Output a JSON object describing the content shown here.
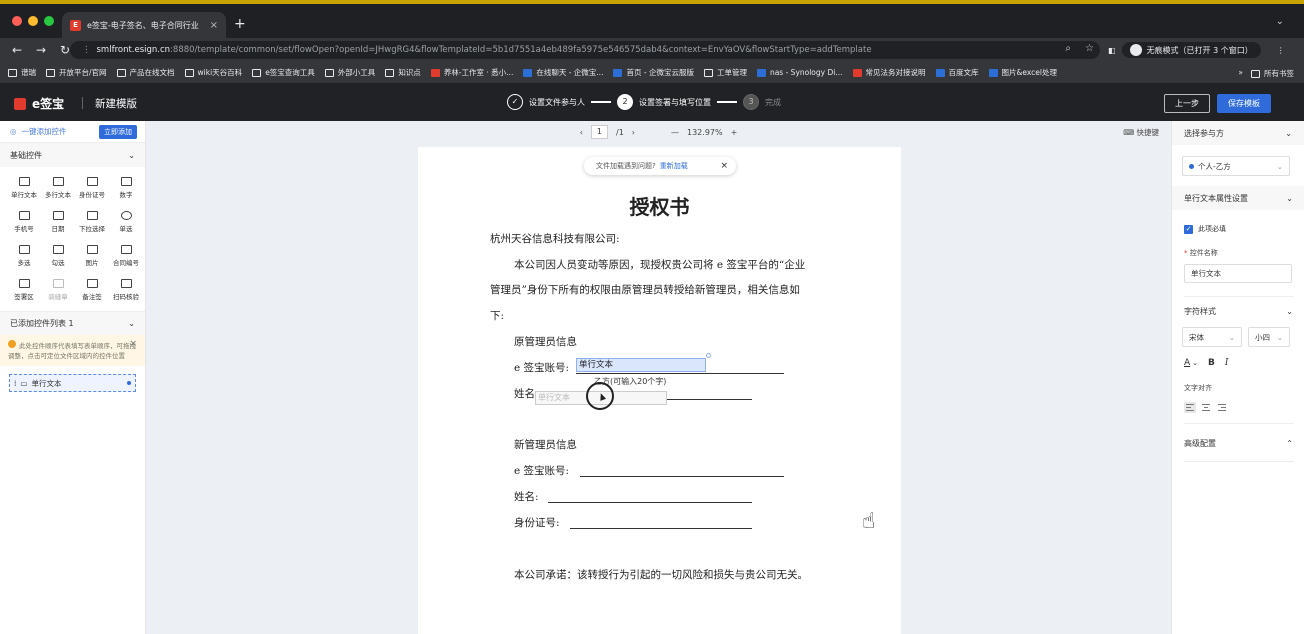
{
  "browser": {
    "tab_title": "e签宝-电子签名、电子合同行业",
    "tab_close": "×",
    "new_tab": "+",
    "url_host": "smlfront.esign.cn",
    "url_rest": ":8880/template/common/set/flowOpen?openId=JHwgRG4&flowTemplateId=5b1d7551a4eb489fa5975e546575dab4&context=EnvYaOV&flowStartType=addTemplate",
    "incognito_label": "无痕模式（已打开 3 个窗口）",
    "bookmarks": [
      "谱瑞",
      "开放平台/官网",
      "产品在线文档",
      "wiki天谷百科",
      "e签宝查询工具",
      "外部小工具",
      "知识点",
      "养林-工作室 · 悉小...",
      "在线聊天 - 企微宝...",
      "首页 - 企微宝云服版",
      "工单管理",
      "nas - Synology Di...",
      "常见法务对接说明",
      "百度文库",
      "图片&excel处理"
    ],
    "bookmarks_more": "»",
    "bookmarks_all": "所有书签"
  },
  "app": {
    "logo_text": "e签宝",
    "page_name": "新建模版",
    "steps": [
      {
        "num": "✓",
        "label": "设置文件参与人"
      },
      {
        "num": "2",
        "label": "设置签署与填写位置"
      },
      {
        "num": "3",
        "label": "完成"
      }
    ],
    "prev_button": "上一步",
    "save_button": "保存模板"
  },
  "left_panel": {
    "quick_add_label": "一键添加控件",
    "quick_add_button": "立即添加",
    "basic_controls_title": "基础控件",
    "controls": [
      {
        "label": "单行文本",
        "icon": "single-line-text-icon"
      },
      {
        "label": "多行文本",
        "icon": "multi-line-text-icon"
      },
      {
        "label": "身份证号",
        "icon": "id-card-icon"
      },
      {
        "label": "数字",
        "icon": "number-icon"
      },
      {
        "label": "手机号",
        "icon": "phone-icon"
      },
      {
        "label": "日期",
        "icon": "date-icon"
      },
      {
        "label": "下拉选择",
        "icon": "dropdown-icon"
      },
      {
        "label": "单选",
        "icon": "radio-icon"
      },
      {
        "label": "多选",
        "icon": "multi-select-icon"
      },
      {
        "label": "勾选",
        "icon": "checkbox-icon"
      },
      {
        "label": "图片",
        "icon": "image-icon"
      },
      {
        "label": "合同编号",
        "icon": "contract-number-icon"
      },
      {
        "label": "签署区",
        "icon": "sign-area-icon"
      },
      {
        "label": "骑缝章",
        "icon": "seam-seal-icon"
      },
      {
        "label": "备注签",
        "icon": "remark-sign-icon"
      },
      {
        "label": "扫码核验",
        "icon": "qr-verify-icon"
      }
    ],
    "added_list_title": "已添加控件列表 1",
    "notice": "此处控件顺序代表填写表单顺序，可拖拽调整，点击可定位文件区域内的控件位置",
    "added_items": [
      {
        "label": "单行文本"
      }
    ]
  },
  "canvas": {
    "page_current": "1",
    "page_total": "/1",
    "zoom": "132.97%",
    "shortcut_label": "快捷键",
    "reload_notice": "文件加载遇到问题?",
    "reload_link": "重新加载",
    "doc": {
      "title": "授权书",
      "salutation": "杭州天谷信息科技有限公司:",
      "para_1": "本公司因人员变动等原因，现授权贵公司将 e 签宝平台的“企业",
      "para_2": "管理员”身份下所有的权限由原管理员转授给新管理员，相关信息如",
      "para_3": "下:",
      "old_admin_heading": "原管理员信息",
      "esign_account_label": "e 签宝账号:",
      "name_label": "姓名:",
      "new_admin_heading": "新管理员信息",
      "new_esign_account_label": "e 签宝账号:",
      "new_name_label": "姓名:",
      "id_label": "身份证号:",
      "commitment": "本公司承诺：该转授行为引起的一切风险和损失与贵公司无关。",
      "field_value": "单行文本",
      "field_hint": "乙方(可输入20个字)",
      "ghost_field": "单行文本"
    }
  },
  "right_panel": {
    "participant_title": "选择参与方",
    "participant_value": "个人-乙方",
    "props_title": "单行文本属性设置",
    "required_label": "此项必填",
    "control_name_label": "控件名称",
    "control_name_value": "单行文本",
    "font_style_title": "字符样式",
    "font_value": "宋体",
    "size_value": "小四",
    "color_label": "A",
    "bold_label": "B",
    "italic_label": "I",
    "align_title": "文字对齐",
    "advanced_title": "高级配置"
  }
}
